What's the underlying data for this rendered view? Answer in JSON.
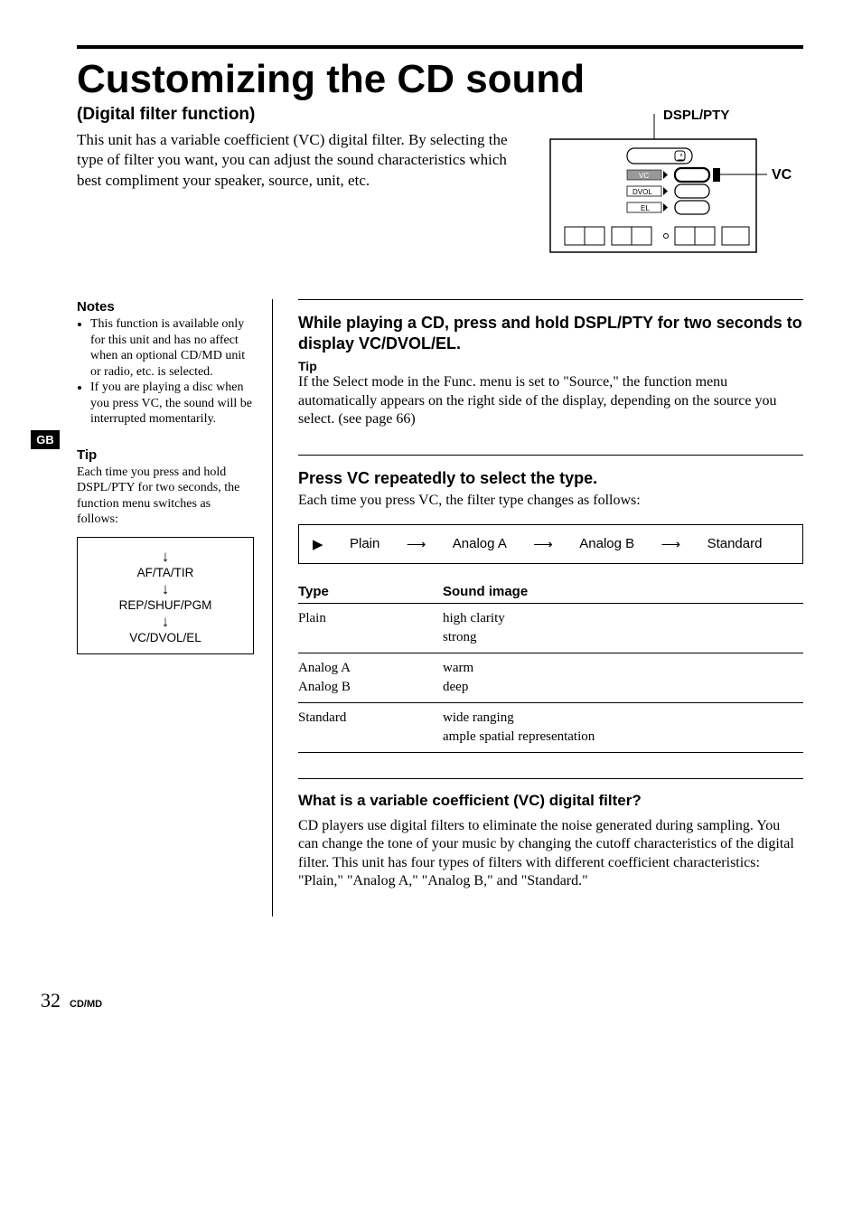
{
  "header": {
    "title": "Customizing the CD sound",
    "subtitle": "(Digital filter function)",
    "intro": "This unit has a variable coefficient (VC) digital filter. By selecting the type of filter you want, you can adjust the sound characteristics which best compliment your speaker, source, unit, etc."
  },
  "diagram": {
    "label_top": "DSPL/PTY",
    "label_right": "VC",
    "btn1": "VC",
    "btn2": "DVOL",
    "btn3": "EL"
  },
  "sidebar": {
    "notes_heading": "Notes",
    "notes": [
      "This function is available only for this unit and has no affect when an optional CD/MD unit or radio, etc. is selected.",
      "If you are playing a disc when you press VC, the sound will be interrupted momentarily."
    ],
    "tip_heading": "Tip",
    "tip_body": "Each time you press and hold DSPL/PTY for two seconds, the function menu switches as follows:",
    "menu_flow": [
      "AF/TA/TIR",
      "REP/SHUF/PGM",
      "VC/DVOL/EL"
    ]
  },
  "gb_label": "GB",
  "steps": {
    "step1": {
      "head": "While playing a CD, press and hold DSPL/PTY for two seconds to display VC/DVOL/EL.",
      "tip_label": "Tip",
      "tip_text": "If the Select mode in the Func. menu is set to \"Source,\" the function menu automatically appears on the right side of the display, depending on the source you select. (see page 66)"
    },
    "step2": {
      "head": "Press VC repeatedly to select the type.",
      "body": "Each time you press VC, the filter type changes as follows:",
      "flow": [
        "Plain",
        "Analog A",
        "Analog B",
        "Standard"
      ],
      "table": {
        "headers": [
          "Type",
          "Sound image"
        ],
        "rows": [
          {
            "type": "Plain",
            "sound": "high clarity\nstrong"
          },
          {
            "type": "Analog A\nAnalog B",
            "sound": "warm\ndeep"
          },
          {
            "type": "Standard",
            "sound": "wide ranging\nample spatial representation"
          }
        ]
      }
    }
  },
  "explain": {
    "head": "What is a variable coefficient (VC) digital filter?",
    "body": "CD players use digital filters to eliminate the noise generated during sampling. You can change the tone of your music by changing the cutoff characteristics of the digital filter. This unit has four types of filters with different coefficient characteristics: \"Plain,\" \"Analog A,\" \"Analog B,\" and \"Standard.\""
  },
  "footer": {
    "page_num": "32",
    "category": "CD/MD"
  }
}
